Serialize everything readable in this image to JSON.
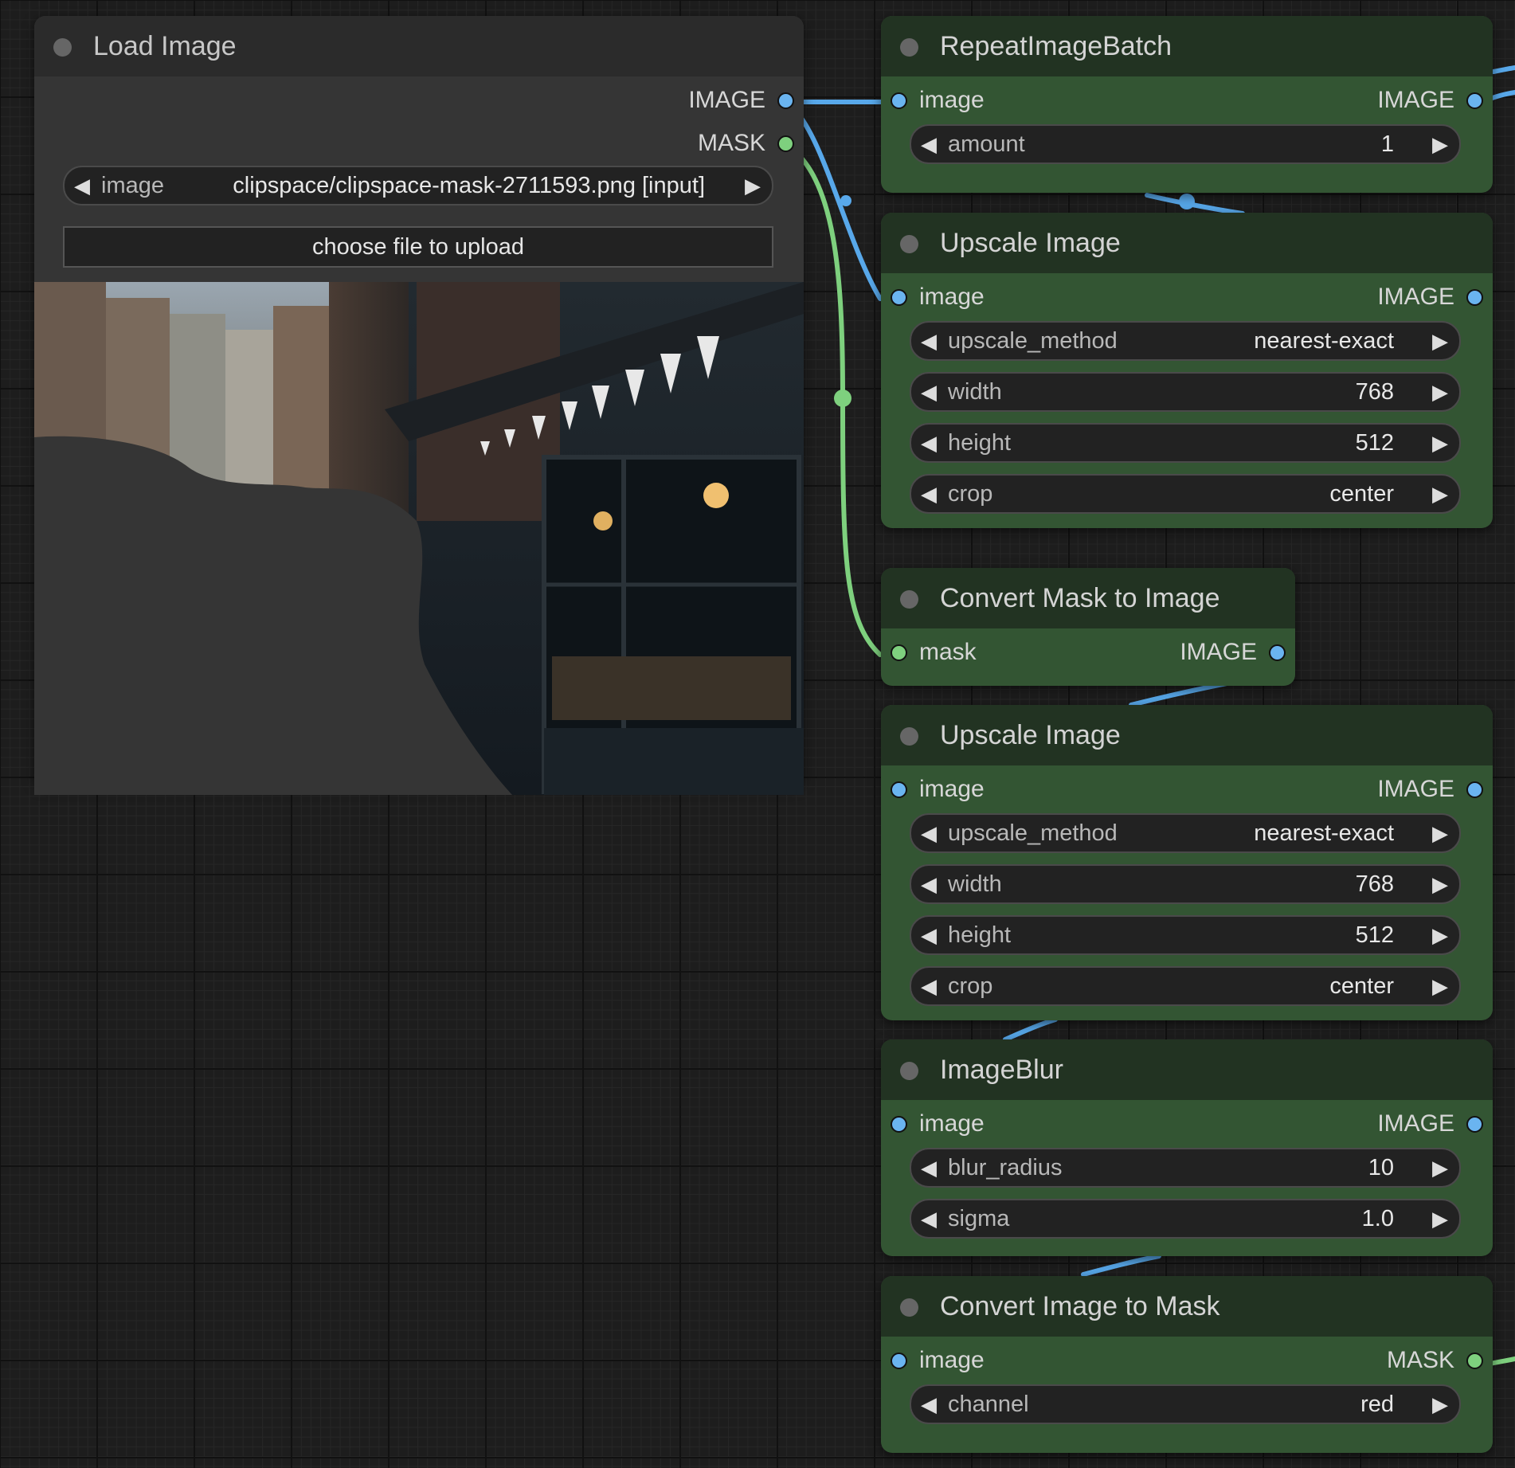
{
  "colors": {
    "image_link": "#58a8ea",
    "mask_link": "#7ed07e",
    "node_gray": "#353535",
    "node_green": "#335533"
  },
  "load_image": {
    "title": "Load Image",
    "outputs": [
      "IMAGE",
      "MASK"
    ],
    "image_widget_label": "image",
    "image_widget_value": "clipspace/clipspace-mask-2711593.png [input]",
    "upload_button": "choose file to upload"
  },
  "repeat_batch": {
    "title": "RepeatImageBatch",
    "input": "image",
    "output": "IMAGE",
    "widgets": [
      {
        "label": "amount",
        "value": "1"
      }
    ]
  },
  "upscale_1": {
    "title": "Upscale Image",
    "input": "image",
    "output": "IMAGE",
    "widgets": [
      {
        "label": "upscale_method",
        "value": "nearest-exact"
      },
      {
        "label": "width",
        "value": "768"
      },
      {
        "label": "height",
        "value": "512"
      },
      {
        "label": "crop",
        "value": "center"
      }
    ]
  },
  "convert_mask": {
    "title": "Convert Mask to Image",
    "input": "mask",
    "output": "IMAGE"
  },
  "upscale_2": {
    "title": "Upscale Image",
    "input": "image",
    "output": "IMAGE",
    "widgets": [
      {
        "label": "upscale_method",
        "value": "nearest-exact"
      },
      {
        "label": "width",
        "value": "768"
      },
      {
        "label": "height",
        "value": "512"
      },
      {
        "label": "crop",
        "value": "center"
      }
    ]
  },
  "image_blur": {
    "title": "ImageBlur",
    "input": "image",
    "output": "IMAGE",
    "widgets": [
      {
        "label": "blur_radius",
        "value": "10"
      },
      {
        "label": "sigma",
        "value": "1.0"
      }
    ]
  },
  "convert_image": {
    "title": "Convert Image to Mask",
    "input": "image",
    "output": "MASK",
    "widgets": [
      {
        "label": "channel",
        "value": "red"
      }
    ]
  },
  "icons": {
    "node_status": "circle-dot-icon",
    "arrow_left": "triangle-left-icon",
    "arrow_right": "triangle-right-icon"
  }
}
